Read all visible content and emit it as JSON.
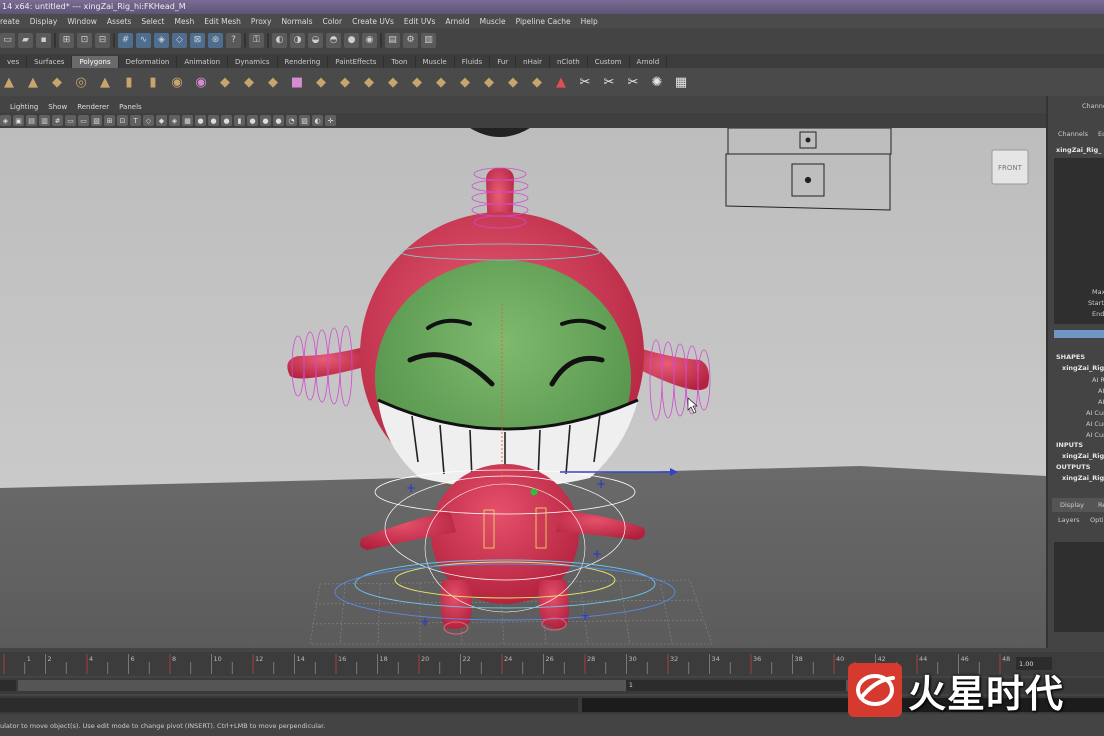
{
  "window": {
    "title": "14 x64: untitled*   ---   xingZai_Rig_hi:FKHead_M"
  },
  "menu": [
    "reate",
    "Display",
    "Window",
    "Assets",
    "Select",
    "Mesh",
    "Edit Mesh",
    "Proxy",
    "Normals",
    "Color",
    "Create UVs",
    "Edit UVs",
    "Arnold",
    "Muscle",
    "Pipeline Cache",
    "Help"
  ],
  "shelf": {
    "tabs": [
      "ves",
      "Surfaces",
      "Polygons",
      "Deformation",
      "Animation",
      "Dynamics",
      "Rendering",
      "PaintEffects",
      "Toon",
      "Muscle",
      "Fluids",
      "Fur",
      "nHair",
      "nCloth",
      "Custom",
      "Arnold"
    ],
    "active_tab": "Polygons"
  },
  "panel": {
    "menu": [
      "Lighting",
      "Show",
      "Renderer",
      "Panels"
    ]
  },
  "viewport": {
    "view_cube_label": "FRONT"
  },
  "channel_box": {
    "header": "Channel",
    "tabs": [
      "Channels",
      "Ed"
    ],
    "node": "xingZai_Rig_",
    "attrs": [
      "Max",
      "Start",
      "End"
    ],
    "shapes_label": "SHAPES",
    "shape_node": "xingZai_Rig",
    "shape_attrs": [
      "AI R",
      "AI",
      "AI",
      "AI Cur",
      "AI Cur",
      "AI Cur"
    ],
    "inputs_label": "INPUTS",
    "input_node": "xingZai_Rig",
    "outputs_label": "OUTPUTS",
    "output_node": "xingZai_Rig",
    "layer_tabs": [
      "Display",
      "Re"
    ],
    "layer_menu": [
      "Layers",
      "Opti"
    ]
  },
  "timeline": {
    "ticks": [
      "1",
      "2",
      "4",
      "6",
      "8",
      "10",
      "12",
      "14",
      "16",
      "18",
      "20",
      "22",
      "24",
      "26",
      "28",
      "30",
      "32",
      "34",
      "36",
      "38",
      "40",
      "42",
      "44",
      "46",
      "48"
    ],
    "current_frame_field": "1.00",
    "range_start": "1"
  },
  "help_line": "ulator to move object(s). Use edit mode to change pivot (INSERT). Ctrl+LMB to move perpendicular.",
  "watermark": {
    "text": "火星时代"
  }
}
